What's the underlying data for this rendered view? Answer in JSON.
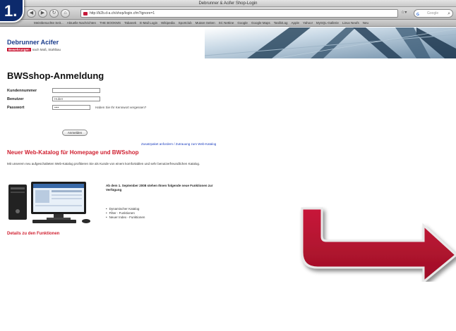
{
  "step": "1.",
  "browser": {
    "title": "Debrunner & Acifer Shop-Login",
    "url": "http://b2b.d-a.ch/shop/login.cfm?ignore=1",
    "search_placeholder": "Google",
    "search_logo": "G",
    "bookmarks": [
      "Meistbesuchte Seit...",
      "Aktuelle Nachrichten",
      "THE BOOKMS",
      "Tabanek",
      "E-Mail Login",
      "Wikipedia",
      "Sportclub",
      "Mutare Seiten",
      "SC Nettine",
      "Google",
      "Google Maps",
      "Tardbit.ag",
      "Apple",
      "Yahoo!",
      "MySQL-Gallerie",
      "Lieux Neufs",
      "Neu"
    ]
  },
  "banner": {
    "logo": "Debrunner Acifer",
    "tag_highlight": "Bewehrungen",
    "tag_text": "nach Maß, Stahlbau"
  },
  "login": {
    "heading": "BWSshop-Anmeldung",
    "customer_label": "Kundennummer",
    "customer_value": "",
    "user_label": "Benutzer",
    "user_value": "Huber",
    "password_label": "Passwort",
    "password_value": "••••",
    "password_hint": "Haben Sie Ihr Kennwort vergessen?",
    "submit_label": "Anmelden",
    "access_link": "Zusatzpaket anfordern / Zutrauung zum Web-Katalog"
  },
  "news": {
    "title": "Neuer Web-Katalog für Homepage und BWSshop",
    "body": "Mit unserem neu aufgeschalteten Web-Katalog profitieren Sie als Kunde von einem komfortablen und sehr benutzerfreundlichen Katalog.",
    "feature_title": "Ab dem 1. September 2008 stehen Ihnen folgende neue Funktionen zur Verfügung",
    "features": [
      "Dynamischer Katalog",
      "Filter - Funktionen",
      "Neuer Index - Funktionen"
    ],
    "details_link": "Details zu den Funktionen"
  },
  "colors": {
    "brand_blue": "#1a3c8c",
    "brand_red": "#d01f2f",
    "arrow_red": "#b3122c"
  }
}
